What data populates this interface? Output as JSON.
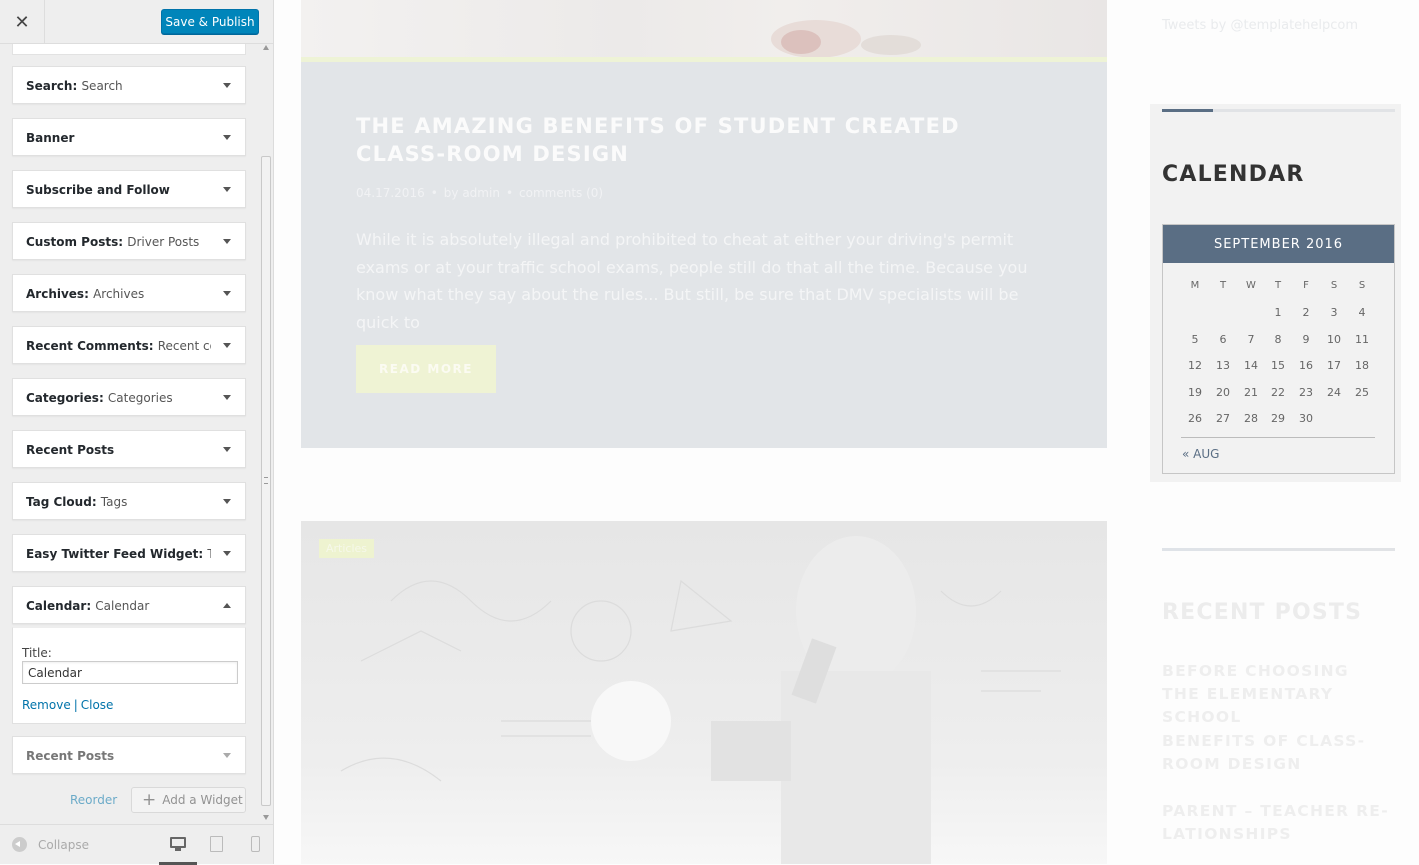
{
  "panel": {
    "close_glyph": "✕",
    "publish_label": "Save & Publish",
    "widgets": [
      {
        "name": "Search",
        "sub": "Search"
      },
      {
        "name": "Banner",
        "sub": ""
      },
      {
        "name": "Subscribe and Follow",
        "sub": ""
      },
      {
        "name": "Custom Posts",
        "sub": "Driver Posts"
      },
      {
        "name": "Archives",
        "sub": "Archives"
      },
      {
        "name": "Recent Comments",
        "sub": "Recent co..."
      },
      {
        "name": "Categories",
        "sub": "Categories"
      },
      {
        "name": "Recent Posts",
        "sub": ""
      },
      {
        "name": "Tag Cloud",
        "sub": "Tags"
      },
      {
        "name": "Easy Twitter Feed Widget",
        "sub": "T..."
      },
      {
        "name": "Calendar",
        "sub": "Calendar"
      },
      {
        "name": "Recent Posts",
        "sub": ""
      }
    ],
    "calendar_form": {
      "title_label": "Title:",
      "title_value": "Calendar",
      "remove_label": "Remove",
      "separator": "|",
      "close_label": "Close"
    },
    "reorder_label": "Reorder",
    "add_widget_label": "Add a Widget",
    "collapse_label": "Collapse",
    "devices": [
      "desktop-icon",
      "tablet-icon",
      "mobile-icon"
    ]
  },
  "preview": {
    "post": {
      "title": "The Amazing Benefits of Student Created Class-room Design",
      "date": "04.17.2016",
      "author": "by admin",
      "comments": "comments (0)",
      "excerpt": "While it is absolutely illegal and prohibited to cheat at either your driving's permit exams or at your traffic school exams, people still do that all the time. Because you know what they say about the rules... But still, be sure that DMV specialists will be quick to",
      "read_more": "READ MORE"
    },
    "post2": {
      "badge": "Articles"
    },
    "sidebar": {
      "tweets_link": "Tweets by @templatehelpcom",
      "calendar": {
        "heading": "CALENDAR",
        "month": "SEPTEMBER 2016",
        "weekdays": [
          "M",
          "T",
          "W",
          "T",
          "F",
          "S",
          "S"
        ],
        "weeks": [
          [
            "",
            "",
            "",
            "1",
            "2",
            "3",
            "4"
          ],
          [
            "5",
            "6",
            "7",
            "8",
            "9",
            "10",
            "11"
          ],
          [
            "12",
            "13",
            "14",
            "15",
            "16",
            "17",
            "18"
          ],
          [
            "19",
            "20",
            "21",
            "22",
            "23",
            "24",
            "25"
          ],
          [
            "26",
            "27",
            "28",
            "29",
            "30",
            "",
            ""
          ]
        ],
        "prev_link": "« AUG"
      },
      "recent_posts": {
        "heading": "RECENT POSTS",
        "items": [
          "Before Choosing the Elementary School",
          "Benefits of Class-room Design",
          "Parent – Teacher Re-lationships"
        ]
      }
    }
  },
  "colors": {
    "publish": "#0085ba",
    "link": "#0073aa",
    "calendar_header": "#5a6e84",
    "read_more": "#eff3d4"
  }
}
